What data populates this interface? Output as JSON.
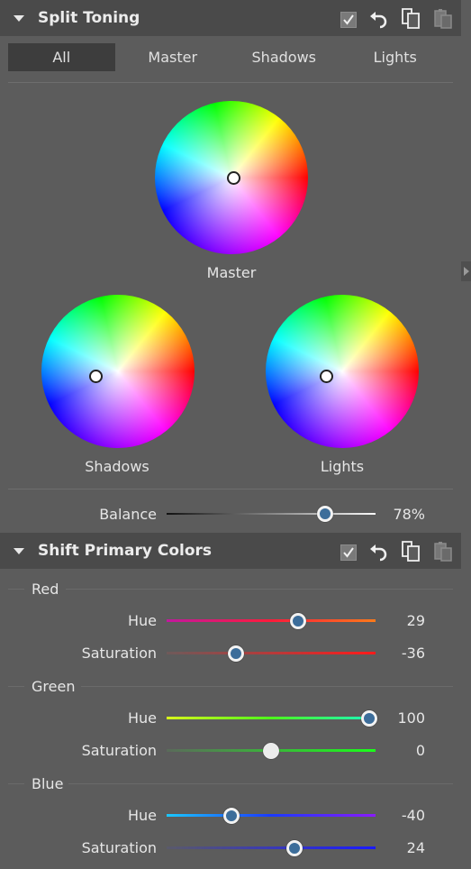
{
  "split_toning": {
    "title": "Split Toning",
    "tabs": [
      "All",
      "Master",
      "Shadows",
      "Lights"
    ],
    "active_tab": "All",
    "wheels": {
      "master_label": "Master",
      "shadows_label": "Shadows",
      "lights_label": "Lights"
    },
    "balance": {
      "label": "Balance",
      "value": "78%",
      "level": 0.76
    }
  },
  "shift_primary": {
    "title": "Shift Primary Colors",
    "groups": [
      {
        "name": "Red",
        "rows": [
          {
            "label": "Hue",
            "value": "29",
            "level": 0.63
          },
          {
            "label": "Saturation",
            "value": "-36",
            "level": 0.33
          }
        ]
      },
      {
        "name": "Green",
        "rows": [
          {
            "label": "Hue",
            "value": "100",
            "level": 0.97
          },
          {
            "label": "Saturation",
            "value": "0",
            "level": 0.5
          }
        ]
      },
      {
        "name": "Blue",
        "rows": [
          {
            "label": "Hue",
            "value": "-40",
            "level": 0.31
          },
          {
            "label": "Saturation",
            "value": "24",
            "level": 0.61
          }
        ]
      }
    ]
  },
  "colors": {
    "header_bg": "#4a4a4a",
    "panel_bg": "#5c5c5c",
    "active_tab_bg": "#3d3d3d",
    "knob_blue": "#3c6d9a"
  }
}
